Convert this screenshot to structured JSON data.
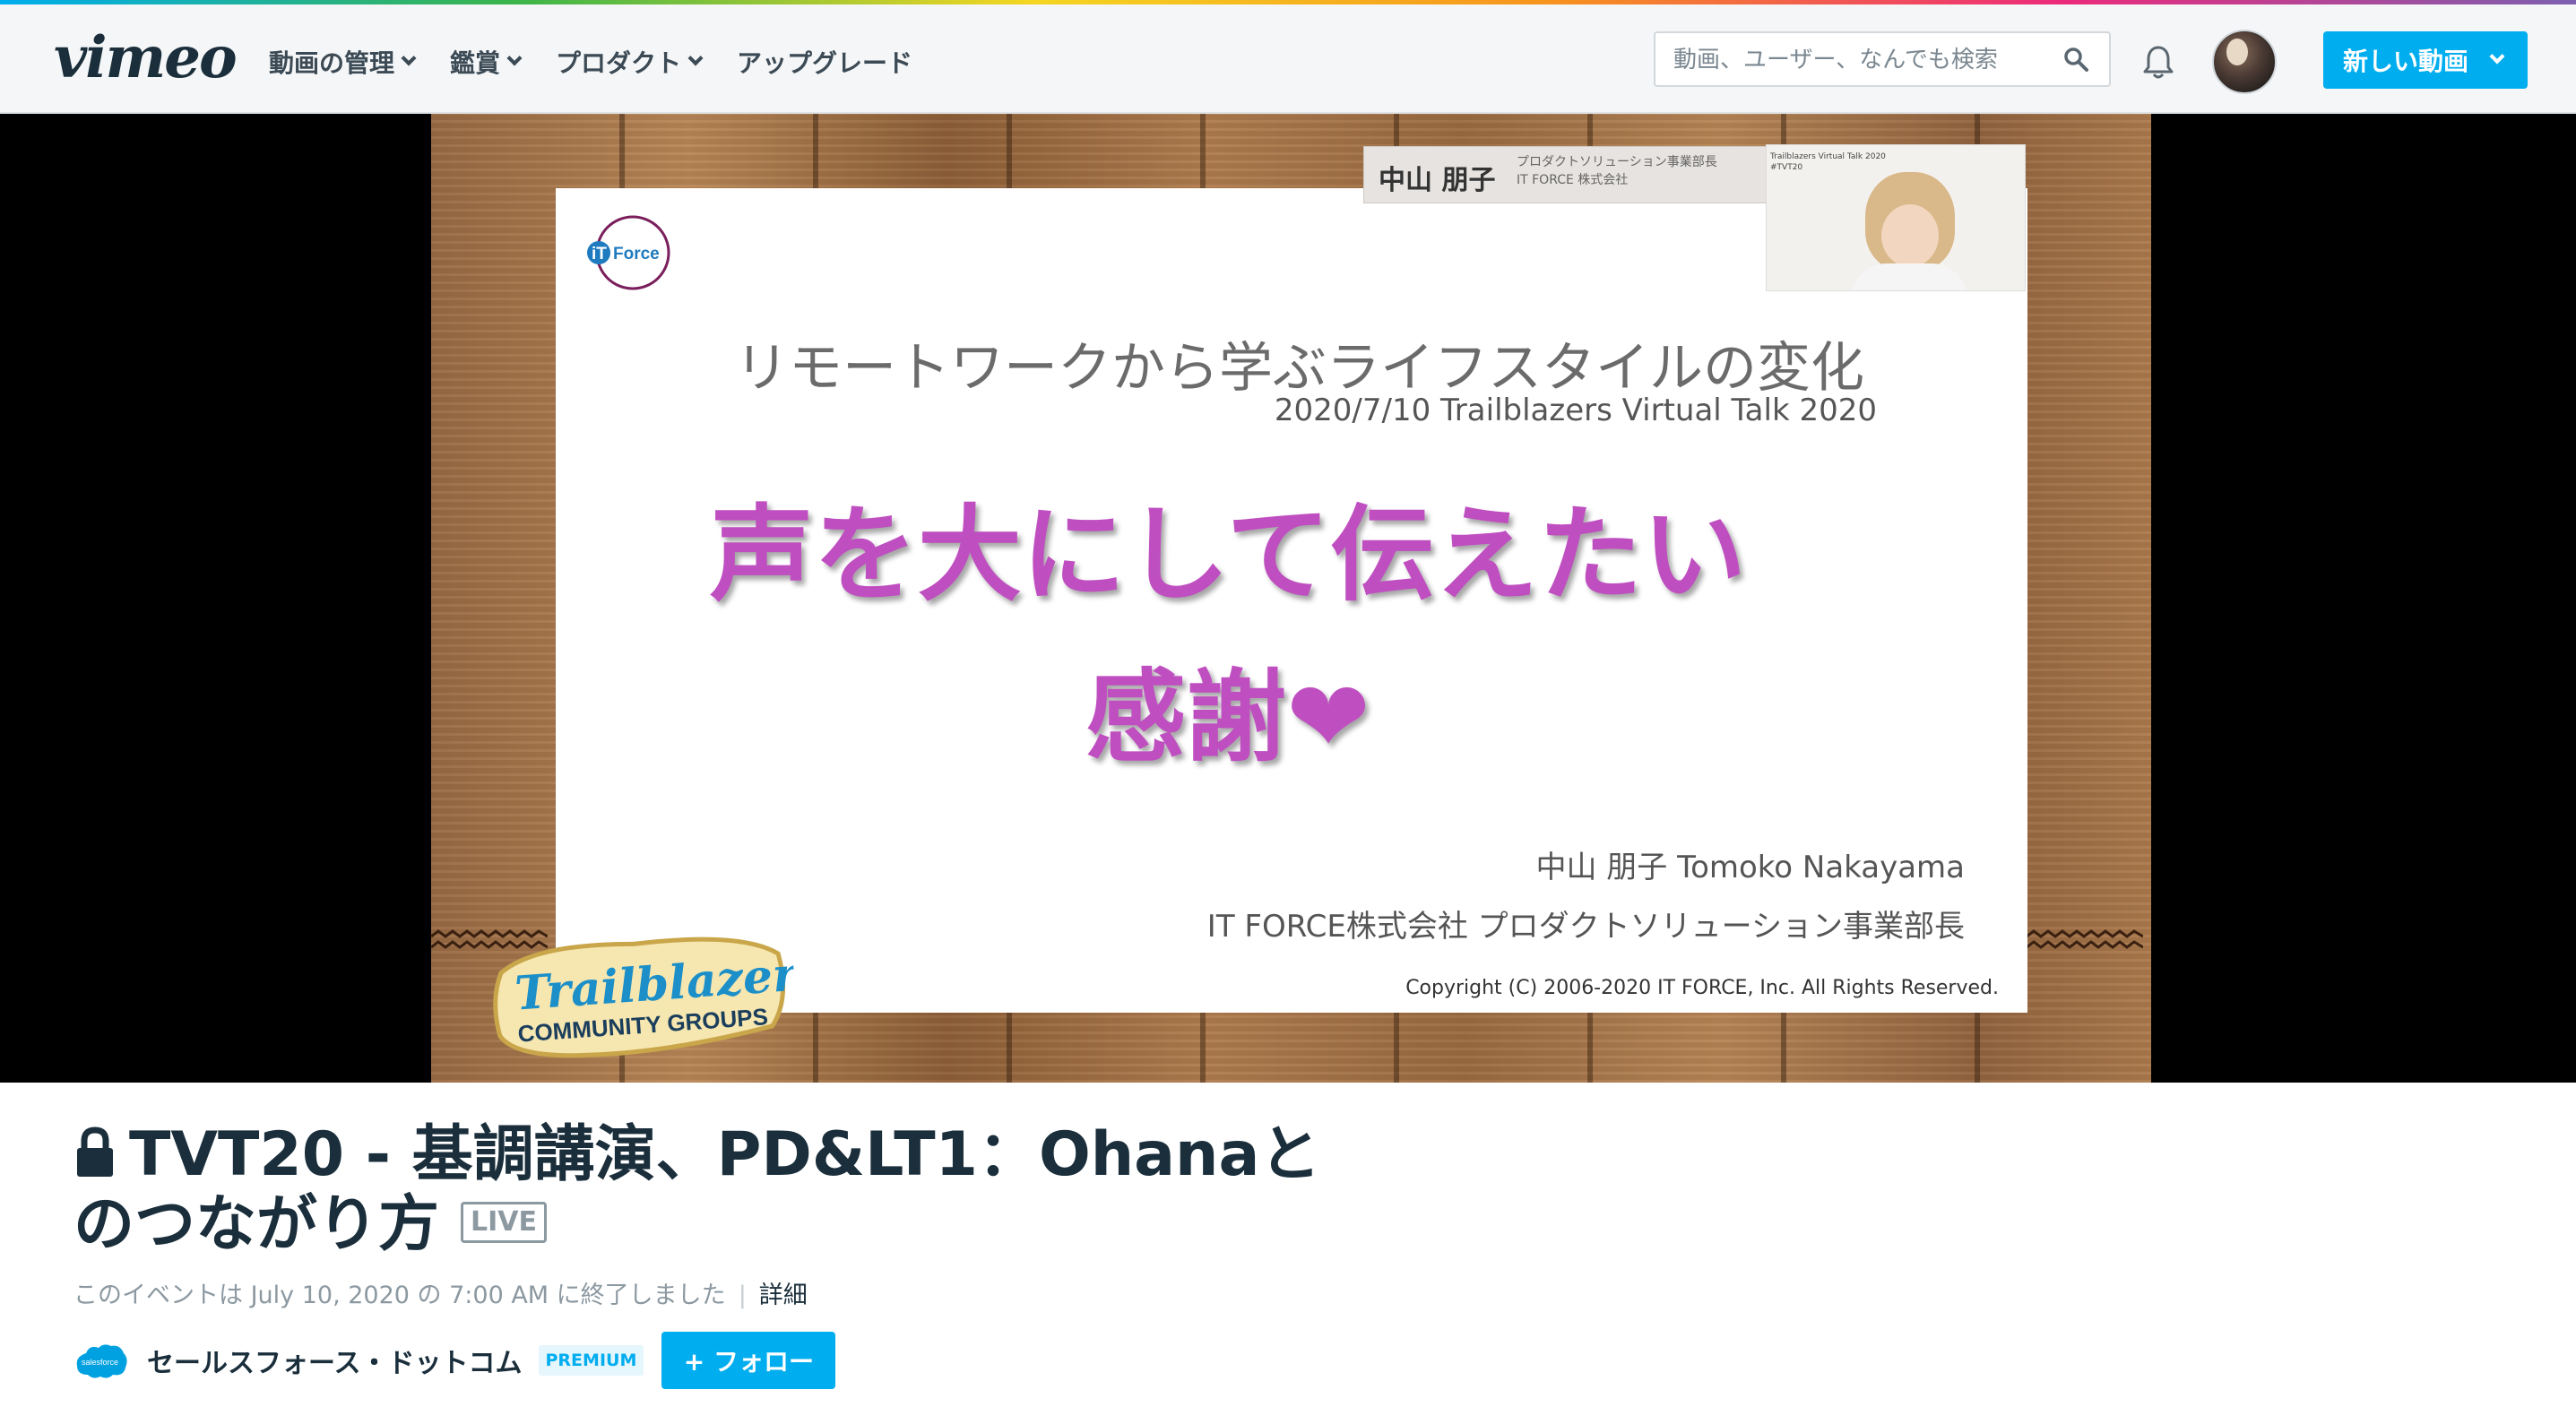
{
  "header": {
    "logo": "vimeo",
    "nav": [
      {
        "label": "動画の管理",
        "dropdown": true
      },
      {
        "label": "鑑賞",
        "dropdown": true
      },
      {
        "label": "プロダクト",
        "dropdown": true
      },
      {
        "label": "アップグレード",
        "dropdown": false
      }
    ],
    "search_placeholder": "動画、ユーザー、なんでも検索",
    "new_video_label": "新しい動画"
  },
  "slide": {
    "logo_text": "iT Force",
    "title": "リモートワークから学ぶライフスタイルの変化",
    "subtitle": "2020/7/10 Trailblazers Virtual Talk 2020",
    "main_line1": "声を大にして伝えたい",
    "main_line2": "感謝❤",
    "speaker": "中山 朋子 Tomoko Nakayama",
    "company": "IT FORCE株式会社  プロダクトソリューション事業部長",
    "copyright": "Copyright (C) 2006-2020 IT FORCE, Inc. All Rights Reserved.",
    "nametag_name": "中山 朋子",
    "nametag_role": "プロダクトソリューション事業部長",
    "nametag_company": "IT FORCE 株式会社",
    "cam_line1": "Trailblazers Virtual Talk 2020",
    "cam_line2": "#TVT20",
    "badge_line1": "Trailblazer",
    "badge_line2": "COMMUNITY GROUPS"
  },
  "video": {
    "title": "TVT20 - 基調講演、PD&LT1：Ohanaとのつながり方",
    "title_line1": "TVT20 - 基調講演、PD&LT1：Ohanaと",
    "title_line2": "のつながり方",
    "live_badge": "LIVE",
    "status": "このイベントは July 10, 2020 の 7:00 AM に終了しました",
    "details_link": "詳細"
  },
  "channel": {
    "logo_text": "salesforce",
    "name": "セールスフォース・ドットコム",
    "badge": "PREMIUM",
    "follow_label": "+ フォロー"
  },
  "colors": {
    "accent": "#00adef",
    "slide_pink": "#bf4fc0",
    "text_dark": "#1a2e3b",
    "text_muted": "#8c99a1"
  }
}
